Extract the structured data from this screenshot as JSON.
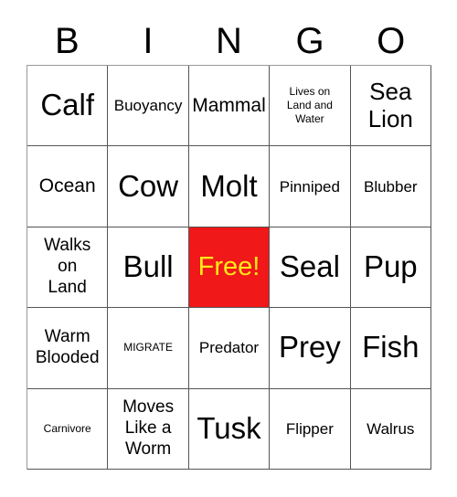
{
  "card": {
    "title_letters": [
      "B",
      "I",
      "N",
      "G",
      "O"
    ],
    "columns": 5,
    "rows": 5,
    "free_color": "#f01818",
    "free_text_color": "#ffe81a",
    "border_color": "#555555",
    "background": "#ffffff",
    "squares": [
      [
        {
          "text": "Calf",
          "size": "xl",
          "free": false
        },
        {
          "text": "Buoyancy",
          "size": "sm",
          "free": false
        },
        {
          "text": "Mammal",
          "size": "md",
          "free": false
        },
        {
          "text": "Lives on\nLand and\nWater",
          "size": "xs",
          "free": false
        },
        {
          "text": "Sea\nLion",
          "size": "lg-multi",
          "free": false
        }
      ],
      [
        {
          "text": "Ocean",
          "size": "md",
          "free": false
        },
        {
          "text": "Cow",
          "size": "xl",
          "free": false
        },
        {
          "text": "Molt",
          "size": "xl",
          "free": false
        },
        {
          "text": "Pinniped",
          "size": "sm",
          "free": false
        },
        {
          "text": "Blubber",
          "size": "sm",
          "free": false
        }
      ],
      [
        {
          "text": "Walks\non\nLand",
          "size": "md-multi",
          "free": false
        },
        {
          "text": "Bull",
          "size": "xl",
          "free": false
        },
        {
          "text": "Free!",
          "size": "lg",
          "free": true
        },
        {
          "text": "Seal",
          "size": "xl",
          "free": false
        },
        {
          "text": "Pup",
          "size": "xl",
          "free": false
        }
      ],
      [
        {
          "text": "Warm\nBlooded",
          "size": "md-multi",
          "free": false
        },
        {
          "text": "MIGRATE",
          "size": "xs",
          "free": false
        },
        {
          "text": "Predator",
          "size": "sm",
          "free": false
        },
        {
          "text": "Prey",
          "size": "xl",
          "free": false
        },
        {
          "text": "Fish",
          "size": "xl",
          "free": false
        }
      ],
      [
        {
          "text": "Carnivore",
          "size": "xs",
          "free": false
        },
        {
          "text": "Moves\nLike a\nWorm",
          "size": "md-multi",
          "free": false
        },
        {
          "text": "Tusk",
          "size": "xl",
          "free": false
        },
        {
          "text": "Flipper",
          "size": "sm",
          "free": false
        },
        {
          "text": "Walrus",
          "size": "sm",
          "free": false
        }
      ]
    ]
  }
}
